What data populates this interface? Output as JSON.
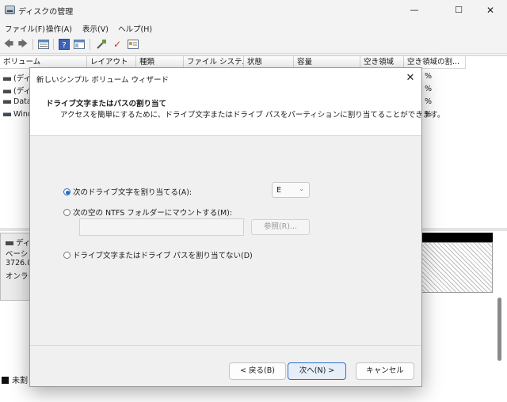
{
  "window": {
    "title": "ディスクの管理",
    "controls": {
      "minimize": "—",
      "maximize": "☐",
      "close": "✕"
    }
  },
  "menu": [
    {
      "label": "ファイル(F)"
    },
    {
      "label": "操作(A)"
    },
    {
      "label": "表示(V)"
    },
    {
      "label": "ヘルプ(H)"
    }
  ],
  "toolbar": {
    "icons": [
      "back-arrow-icon",
      "forward-arrow-icon",
      "disk-list-icon",
      "help-icon",
      "properties-icon",
      "connect-icon",
      "check-icon",
      "settings-icon"
    ],
    "glyphs": {
      "back": "🡄",
      "forward": "🡆",
      "help": "?",
      "check": "✓"
    }
  },
  "volume_table": {
    "columns": [
      "ボリューム",
      "レイアウト",
      "種類",
      "ファイル システム",
      "状態",
      "容量",
      "空き領域",
      "空き領域の割..."
    ],
    "rows": [
      {
        "name": "(ディ",
        "free_pct": "%"
      },
      {
        "name": "(ディ",
        "free_pct": "%"
      },
      {
        "name": "Data",
        "free_pct": "%"
      },
      {
        "name": "Wind",
        "free_pct": "%"
      }
    ]
  },
  "disk_panel": {
    "disk_name": "ディ",
    "disk_type": "ベーシッ",
    "disk_size": "3726.0",
    "disk_status": "オンライ",
    "legend_label": "未割"
  },
  "wizard": {
    "title": "新しいシンプル ボリューム ウィザード",
    "close": "✕",
    "header_title": "ドライブ文字またはパスの割り当て",
    "header_subtitle": "アクセスを簡単にするために、ドライブ文字またはドライブ パスをパーティションに割り当てることができます。",
    "option_assign_letter": "次のドライブ文字を割り当てる(A):",
    "option_mount_folder": "次の空の NTFS フォルダーにマウントする(M):",
    "option_no_letter": "ドライブ文字またはドライブ パスを割り当てない(D)",
    "selected_letter": "E",
    "select_chevron": "⌄",
    "path_value": "",
    "browse_label": "参照(R)...",
    "back_label": "< 戻る(B)",
    "next_label": "次へ(N) >",
    "cancel_label": "キャンセル"
  }
}
